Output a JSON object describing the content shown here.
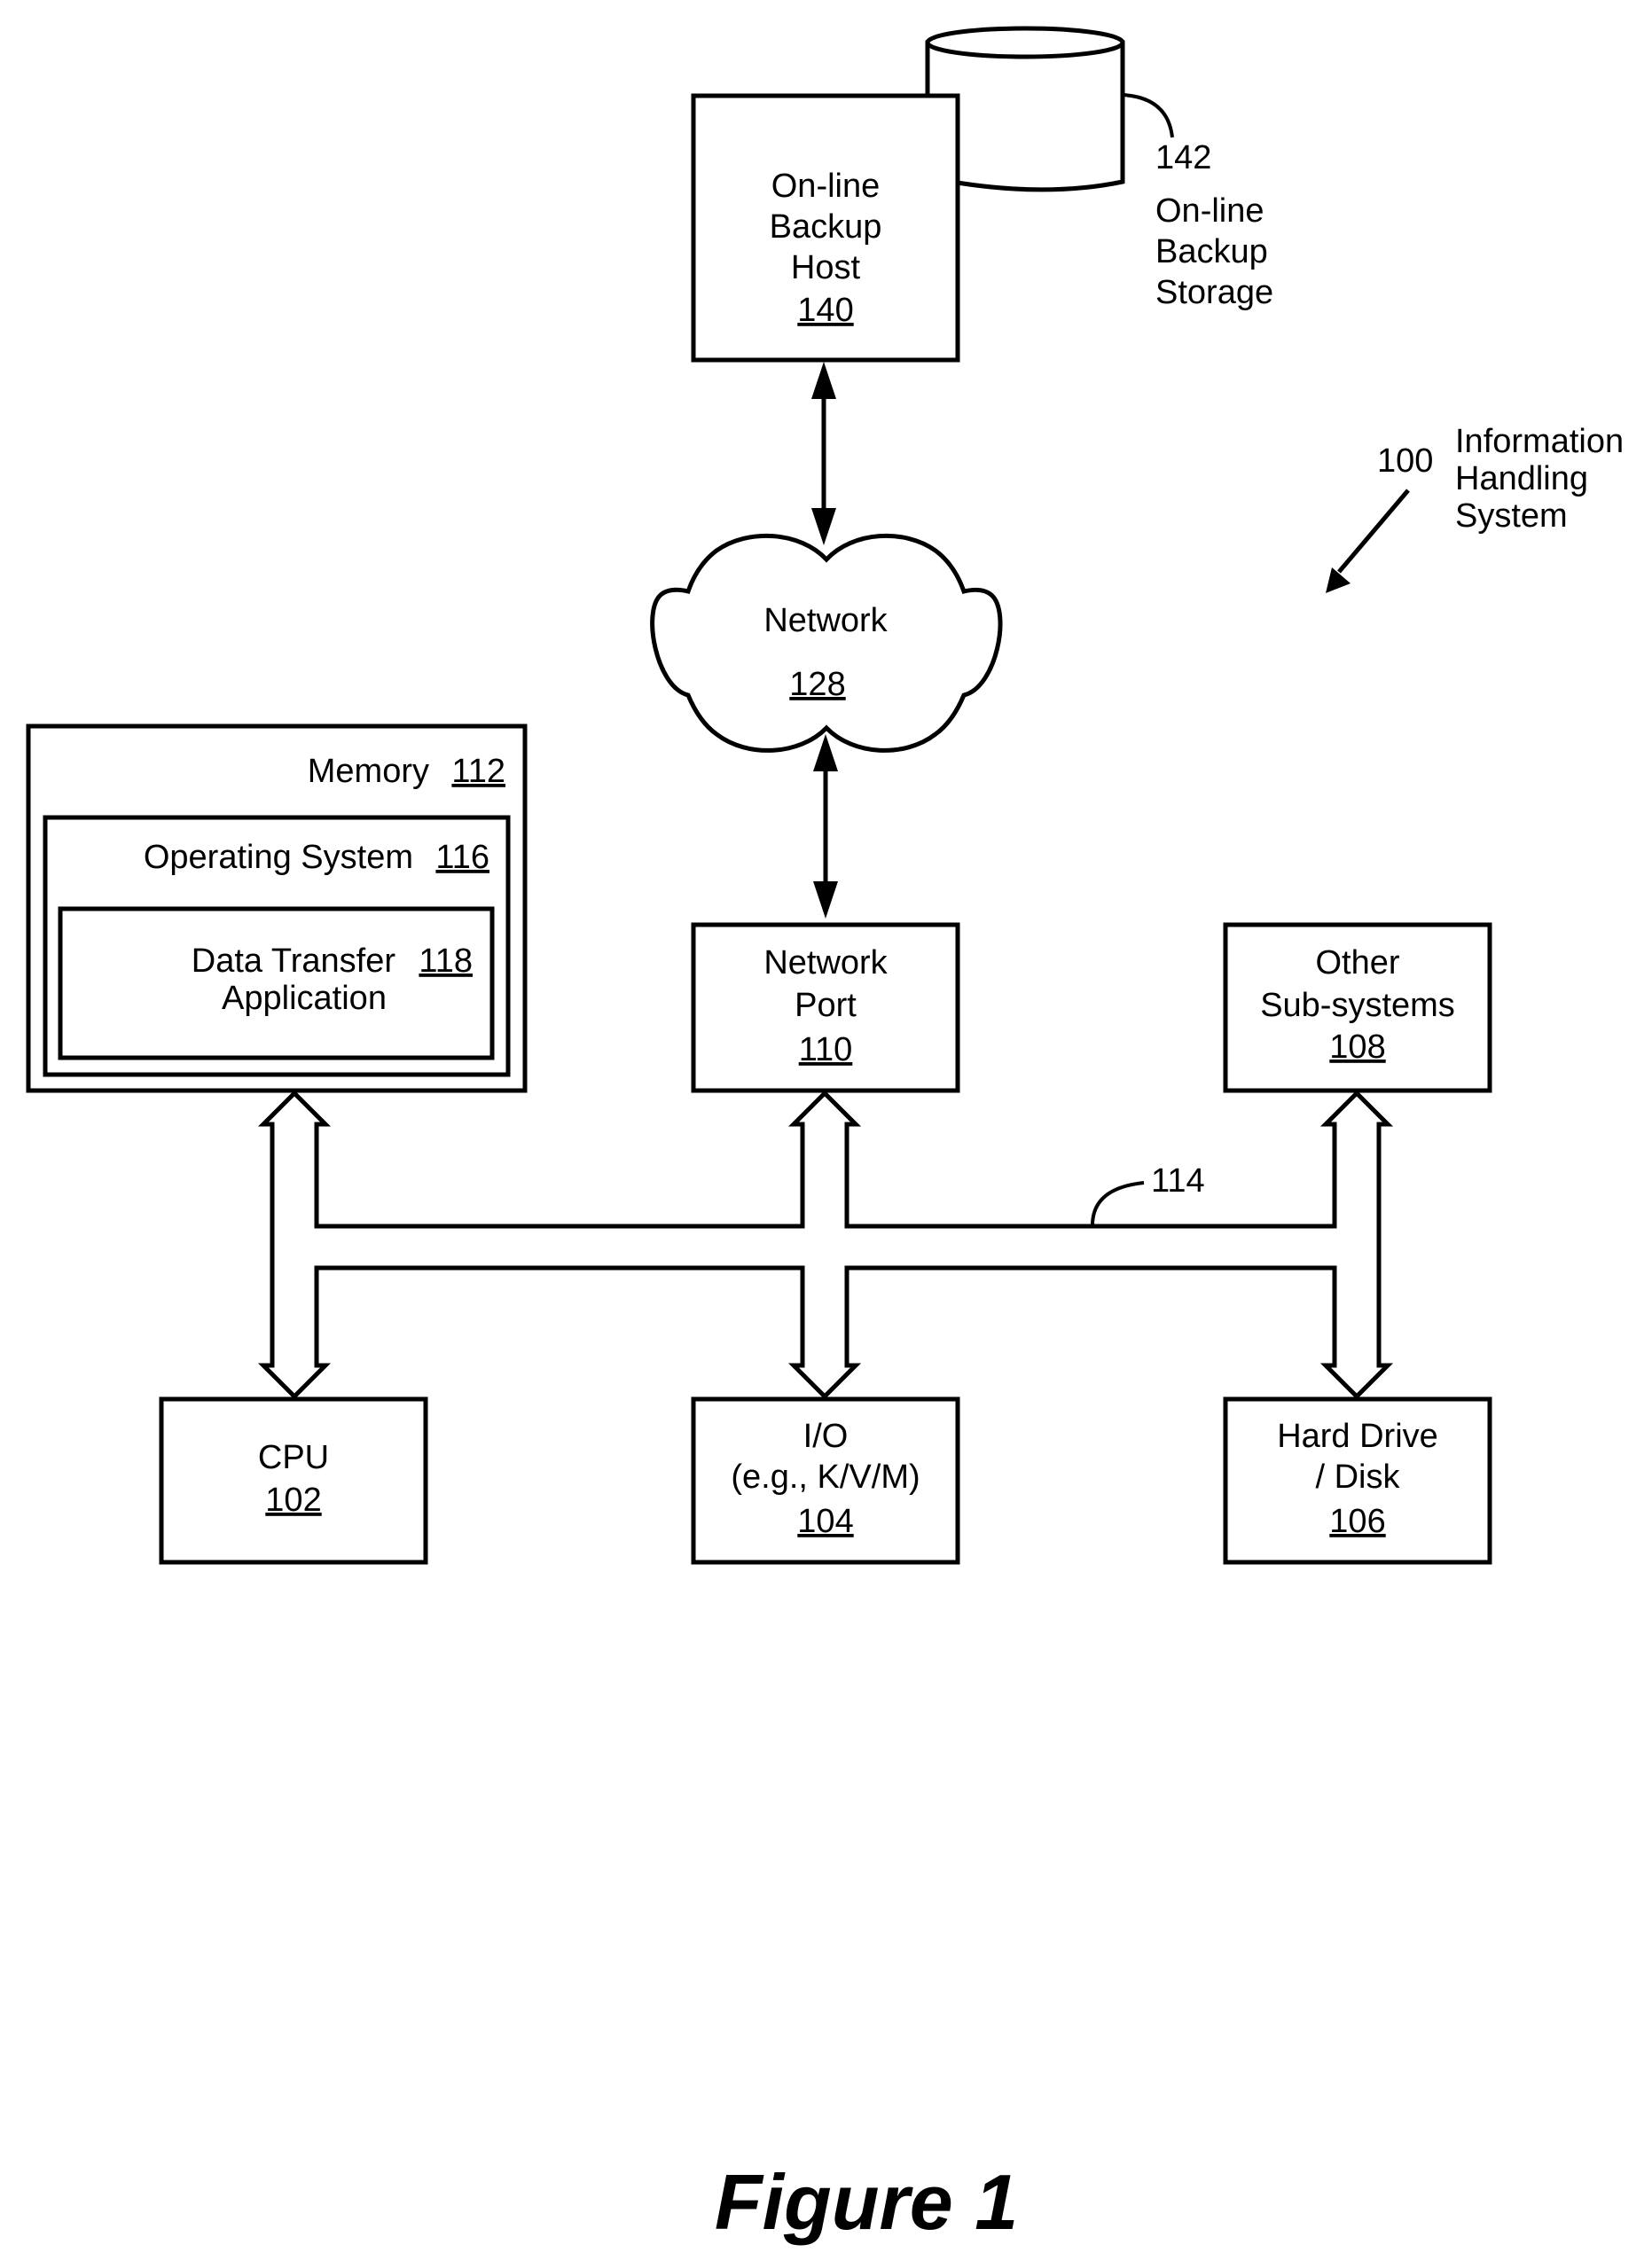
{
  "figure": {
    "title": "Figure 1",
    "system_ref": "100",
    "system_label": [
      "Information",
      "Handling",
      "System"
    ],
    "bus_ref": "114"
  },
  "colors": {
    "ink": "#000000",
    "background": "#ffffff"
  },
  "nodes": {
    "backup_host": {
      "lines": [
        "On-line",
        "Backup",
        "Host"
      ],
      "ref": "140"
    },
    "backup_storage": {
      "ref": "142",
      "lines": [
        "On-line",
        "Backup",
        "Storage"
      ]
    },
    "network": {
      "lines": [
        "Network"
      ],
      "ref": "128"
    },
    "memory": {
      "label": "Memory",
      "ref": "112"
    },
    "operating_system": {
      "label": "Operating System",
      "ref": "116"
    },
    "data_transfer_app": {
      "lines": [
        "Data Transfer",
        "Application"
      ],
      "ref": "118"
    },
    "network_port": {
      "lines": [
        "Network",
        "Port"
      ],
      "ref": "110"
    },
    "other_subsystems": {
      "lines": [
        "Other",
        "Sub-systems"
      ],
      "ref": "108"
    },
    "cpu": {
      "lines": [
        "CPU"
      ],
      "ref": "102"
    },
    "io": {
      "lines": [
        "I/O",
        "(e.g., K/V/M)"
      ],
      "ref": "104"
    },
    "hard_drive": {
      "lines": [
        "Hard Drive",
        "/ Disk"
      ],
      "ref": "106"
    }
  },
  "connections": [
    {
      "from": "backup_host",
      "to": "network",
      "type": "bidirectional-arrow"
    },
    {
      "from": "network",
      "to": "network_port",
      "type": "bidirectional-arrow"
    },
    {
      "from": "memory",
      "to": "bus",
      "type": "bidirectional-block-arrow"
    },
    {
      "from": "network_port",
      "to": "bus",
      "type": "block-arrow"
    },
    {
      "from": "other_subsystems",
      "to": "bus",
      "type": "bidirectional-block-arrow"
    },
    {
      "from": "bus",
      "to": "cpu",
      "type": "block-arrow"
    },
    {
      "from": "bus",
      "to": "io",
      "type": "block-arrow"
    },
    {
      "from": "bus",
      "to": "hard_drive",
      "type": "block-arrow"
    }
  ]
}
